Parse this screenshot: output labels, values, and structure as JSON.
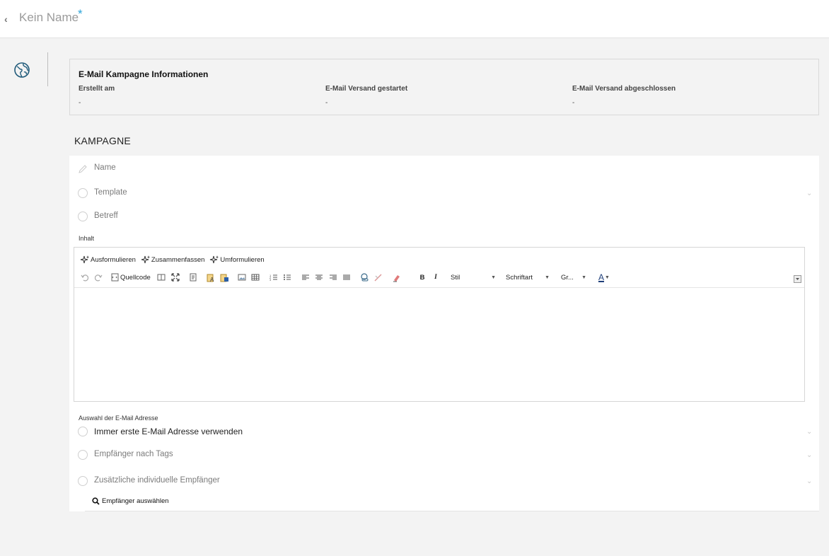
{
  "header": {
    "title": "Kein Name",
    "unsaved_marker": "*"
  },
  "info": {
    "title": "E-Mail Kampagne Informationen",
    "columns": [
      {
        "label": "Erstellt am",
        "value": "-"
      },
      {
        "label": "E-Mail Versand gestartet",
        "value": "-"
      },
      {
        "label": "E-Mail Versand abgeschlossen",
        "value": "-"
      }
    ]
  },
  "section": {
    "heading": "KAMPAGNE"
  },
  "fields": {
    "name": "Name",
    "template": "Template",
    "subject": "Betreff",
    "content_label": "Inhalt",
    "address_label": "Auswahl der E-Mail Adresse",
    "first_address": "Immer erste E-Mail Adresse verwenden",
    "by_tags": "Empfänger nach Tags",
    "individual": "Zusätzliche individuelle Empfänger",
    "select_recipients": "Empfänger auswählen"
  },
  "editor": {
    "ai_actions": [
      "Ausformulieren",
      "Zusammenfassen",
      "Umformulieren"
    ],
    "source_label": "Quellcode",
    "bold_label": "B",
    "italic_label": "I",
    "style_label": "Stil",
    "font_label": "Schriftart",
    "size_label": "Gr...",
    "color_label": "A"
  },
  "colors": {
    "accent": "#2aa3d8",
    "icon_blue": "#1f5a7a"
  }
}
